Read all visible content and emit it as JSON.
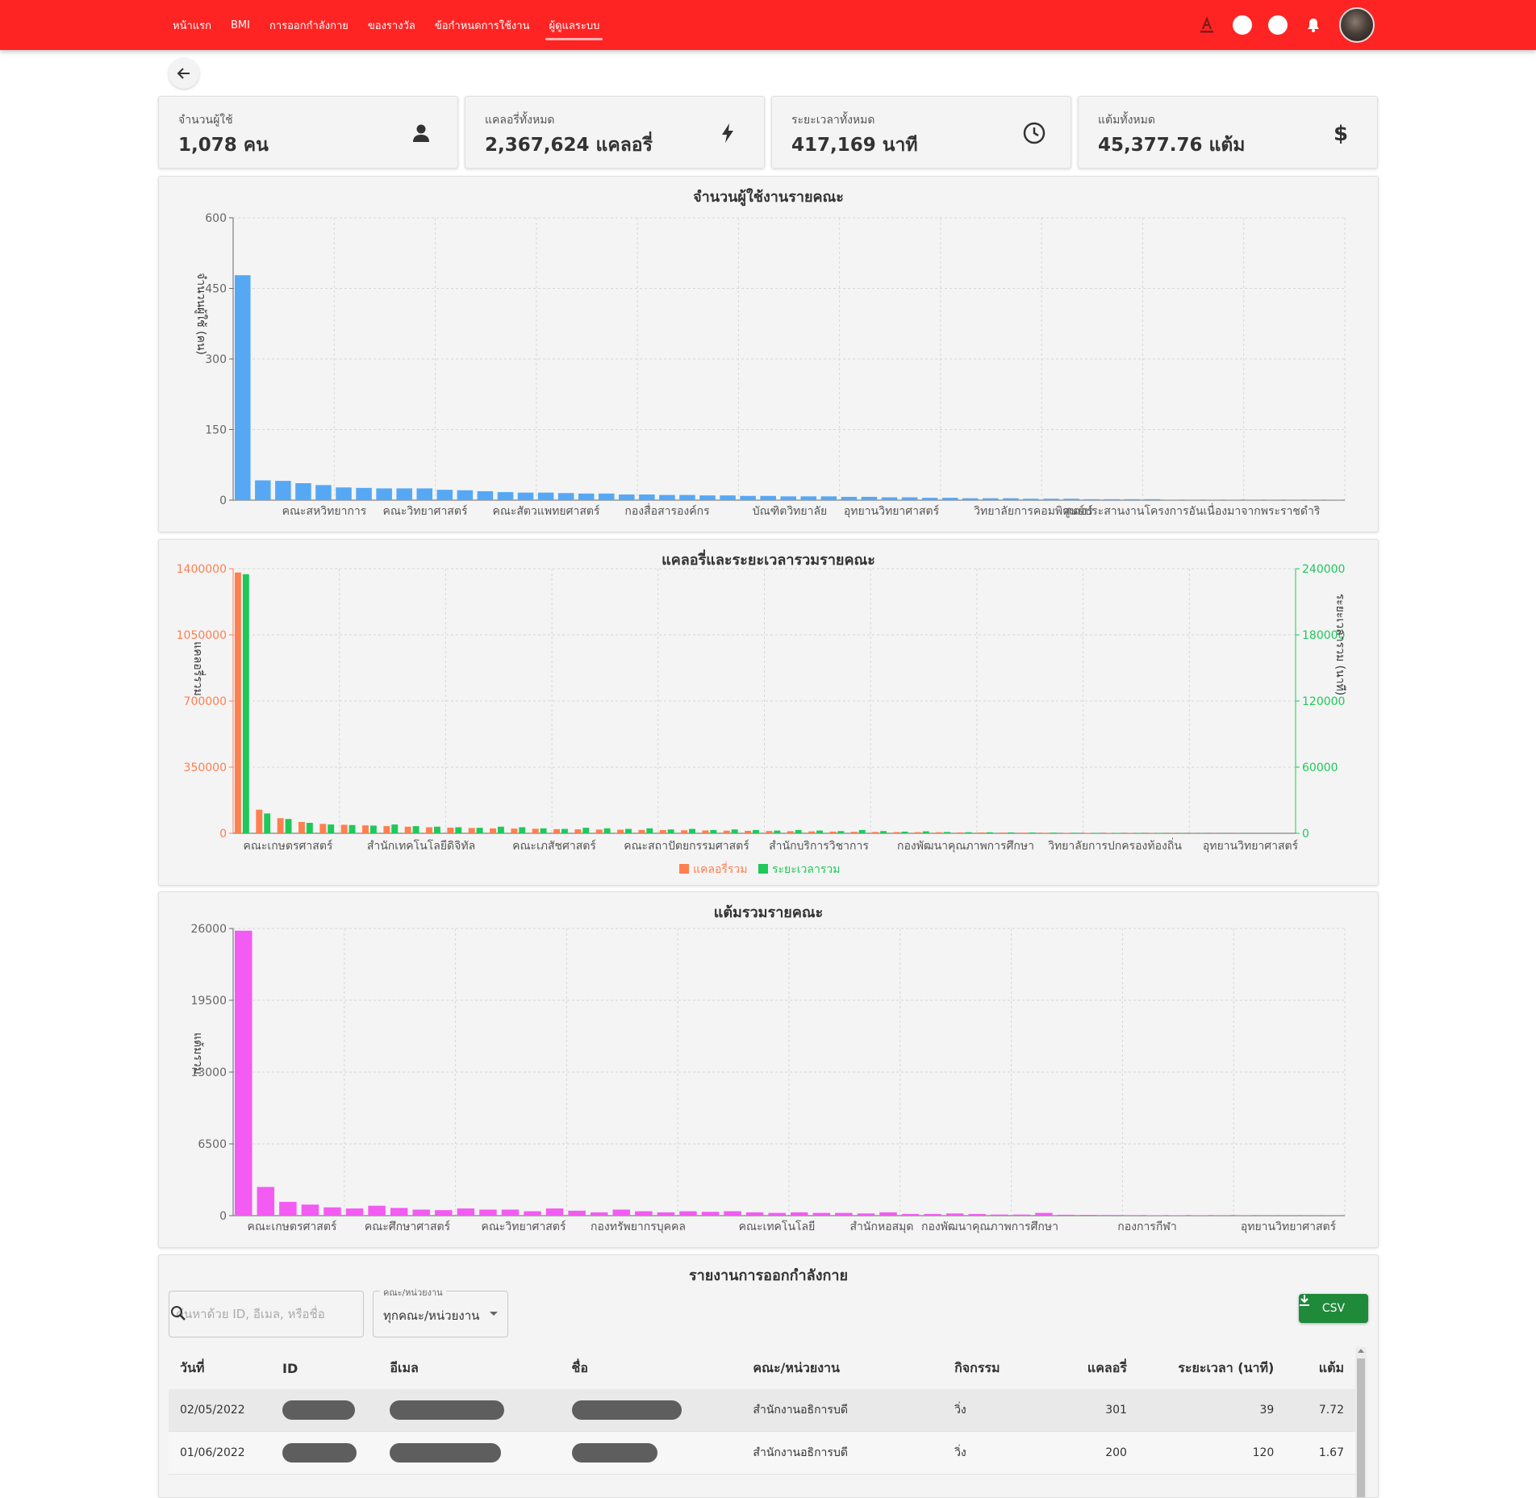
{
  "nav": {
    "items": [
      "หน้าแรก",
      "BMI",
      "การออกกำลังกาย",
      "ของรางวัล",
      "ข้อกำหนดการใช้งาน",
      "ผู้ดูแลระบบ"
    ],
    "active": "ผู้ดูแลระบบ"
  },
  "stats": [
    {
      "label": "จำนวนผู้ใช้",
      "value": "1,078 คน",
      "icon": "person-icon"
    },
    {
      "label": "แคลอรี่ทั้งหมด",
      "value": "2,367,624 แคลอรี่",
      "icon": "lightning-icon"
    },
    {
      "label": "ระยะเวลาทั้งหมด",
      "value": "417,169 นาที",
      "icon": "clock-icon"
    },
    {
      "label": "แต้มทั้งหมด",
      "value": "45,377.76 แต้ม",
      "icon": "dollar-icon"
    }
  ],
  "colors": {
    "brand": "#ff2424",
    "users_bar": "#56a8f5",
    "calories": "#ff7f4f",
    "duration": "#1ec95a",
    "points": "#f25cf2",
    "csv": "#1f8a3a"
  },
  "chart_data": [
    {
      "type": "bar",
      "title": "จำนวนผู้ใช้งานรายคณะ",
      "ylabel": "จำนวนผู้ใช้ (คน)",
      "ylim": [
        0,
        600
      ],
      "yticks": [
        0,
        150,
        300,
        450,
        600
      ],
      "grid": true,
      "shown_labels": [
        "คณะสหวิทยาการ",
        "คณะวิทยาศาสตร์",
        "คณะสัตวแพทยศาสตร์",
        "กองสื่อสารองค์กร",
        "บัณฑิตวิทยาลัย",
        "อุทยานวิทยาศาสตร์",
        "วิทยาลัยการคอมพิวเตอร์",
        "ศูนย์ประสานงานโครงการอันเนื่องมาจากพระราชดำริ"
      ],
      "values": [
        478,
        42,
        41,
        36,
        32,
        27,
        26,
        25,
        25,
        25,
        22,
        21,
        19,
        17,
        16,
        16,
        15,
        14,
        14,
        12,
        12,
        11,
        11,
        10,
        10,
        9,
        9,
        8,
        8,
        8,
        7,
        7,
        6,
        6,
        5,
        5,
        4,
        4,
        4,
        3,
        3,
        3,
        2,
        2,
        2,
        2,
        1,
        1,
        1,
        1,
        1,
        1,
        1,
        1,
        1
      ]
    },
    {
      "type": "bar",
      "title": "แคลอรี่และระยะเวลารวมรายคณะ",
      "ylabel": "แคลอรี่รวม",
      "y2label": "ระยะเวลารวม (นาที)",
      "ylim": [
        0,
        1400000
      ],
      "yticks": [
        0,
        350000,
        700000,
        1050000,
        1400000
      ],
      "y2lim": [
        0,
        240000
      ],
      "y2ticks": [
        0,
        60000,
        120000,
        180000,
        240000
      ],
      "grid": true,
      "legend_position": "bottom",
      "shown_labels": [
        "คณะเกษตรศาสตร์",
        "สำนักเทคโนโลยีดิจิทัล",
        "คณะเภสัชศาสตร์",
        "คณะสถาปัตยกรรมศาสตร์",
        "สำนักบริการวิชาการ",
        "กองพัฒนาคุณภาพการศึกษา",
        "วิทยาลัยการปกครองท้องถิ่น",
        "อุทยานวิทยาศาสตร์"
      ],
      "series": [
        {
          "name": "แคลอรี่รวม",
          "values": [
            1380000,
            125000,
            80000,
            60000,
            50000,
            45000,
            42000,
            38000,
            35000,
            32000,
            30000,
            28000,
            26000,
            25000,
            24000,
            22000,
            21000,
            20000,
            19000,
            18000,
            17000,
            16000,
            15000,
            14000,
            13000,
            12000,
            11000,
            10000,
            9000,
            8000,
            7000,
            6500,
            6000,
            5500,
            5000,
            4500,
            4000,
            3500,
            3000,
            2500,
            2000,
            1800,
            1500,
            1200,
            1000,
            800,
            600,
            400,
            300,
            200
          ]
        },
        {
          "name": "ระยะเวลารวม",
          "values": [
            235000,
            18000,
            13000,
            9500,
            8000,
            7500,
            7000,
            8000,
            6500,
            6000,
            5500,
            5000,
            6000,
            5500,
            4500,
            4000,
            5000,
            4500,
            4000,
            4500,
            3500,
            4000,
            3000,
            3500,
            3000,
            2500,
            3000,
            2500,
            2000,
            3000,
            2000,
            1500,
            1800,
            1200,
            1000,
            900,
            800,
            700,
            600,
            500,
            400,
            350,
            300,
            250,
            200,
            150,
            120,
            100,
            80,
            50
          ]
        }
      ]
    },
    {
      "type": "bar",
      "title": "แต้มรวมรายคณะ",
      "ylabel": "แต้มรวม",
      "ylim": [
        0,
        26000
      ],
      "yticks": [
        0,
        6500,
        13000,
        19500,
        26000
      ],
      "grid": true,
      "shown_labels": [
        "คณะเกษตรศาสตร์",
        "คณะศึกษาศาสตร์",
        "คณะวิทยาศาสตร์",
        "กองทรัพยากรบุคคล",
        "คณะเทคโนโลยี",
        "สำนักหอสมุด",
        "กองพัฒนาคุณภาพการศึกษา",
        "กองการกีฬา",
        "อุทยานวิทยาศาสตร์"
      ],
      "values": [
        25800,
        2600,
        1250,
        1000,
        750,
        650,
        900,
        700,
        550,
        500,
        650,
        550,
        550,
        400,
        650,
        450,
        300,
        550,
        400,
        300,
        400,
        350,
        400,
        300,
        250,
        300,
        250,
        250,
        200,
        300,
        150,
        150,
        200,
        150,
        100,
        100,
        250,
        80,
        70,
        60,
        50,
        40,
        30,
        30,
        20,
        20,
        10,
        10,
        10,
        10
      ]
    }
  ],
  "report": {
    "title": "รายงานการออกกำลังกาย",
    "search_placeholder": "ค้นหาด้วย ID, อีเมล, หรือชื่อ",
    "filter_label": "คณะ/หน่วยงาน",
    "filter_value": "ทุกคณะ/หน่วยงาน",
    "csv_label": "CSV",
    "columns": [
      "วันที่",
      "ID",
      "อีเมล",
      "ชื่อ",
      "คณะ/หน่วยงาน",
      "กิจกรรม",
      "แคลอรี่",
      "ระยะเวลา (นาที)",
      "แต้ม"
    ],
    "rows": [
      {
        "date": "02/05/2022",
        "faculty": "สำนักงานอธิการบดี",
        "activity": "วิ่ง",
        "calories": "301",
        "duration": "39",
        "points": "7.72"
      },
      {
        "date": "01/06/2022",
        "faculty": "สำนักงานอธิการบดี",
        "activity": "วิ่ง",
        "calories": "200",
        "duration": "120",
        "points": "1.67"
      }
    ]
  }
}
